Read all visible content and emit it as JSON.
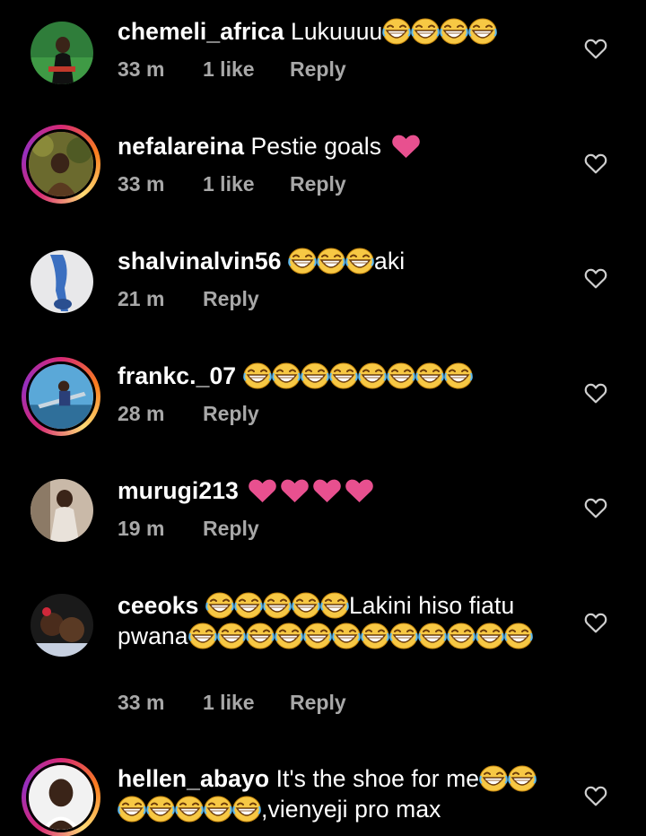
{
  "comments": [
    {
      "username": "chemeli_africa",
      "segments": [
        {
          "t": "text",
          "v": " Lukuuuu"
        },
        {
          "t": "emoji",
          "n": 4
        }
      ],
      "time": "33 m",
      "likes": "1 like",
      "reply": "Reply",
      "story_ring": false
    },
    {
      "username": "nefalareina",
      "segments": [
        {
          "t": "text",
          "v": " Pestie goals "
        },
        {
          "t": "heart",
          "n": 1
        }
      ],
      "time": "33 m",
      "likes": "1 like",
      "reply": "Reply",
      "story_ring": true
    },
    {
      "username": "shalvinalvin56",
      "segments": [
        {
          "t": "text",
          "v": " "
        },
        {
          "t": "emoji",
          "n": 3
        },
        {
          "t": "text",
          "v": "aki"
        }
      ],
      "time": "21 m",
      "likes": "",
      "reply": "Reply",
      "story_ring": false
    },
    {
      "username": "frankc._07",
      "segments": [
        {
          "t": "text",
          "v": " "
        },
        {
          "t": "emoji",
          "n": 8
        }
      ],
      "time": "28 m",
      "likes": "",
      "reply": "Reply",
      "story_ring": true
    },
    {
      "username": "murugi213",
      "segments": [
        {
          "t": "text",
          "v": " "
        },
        {
          "t": "heart",
          "n": 4
        }
      ],
      "time": "19 m",
      "likes": "",
      "reply": "Reply",
      "story_ring": false
    },
    {
      "username": "ceeoks",
      "segments": [
        {
          "t": "text",
          "v": " "
        },
        {
          "t": "emoji",
          "n": 5
        },
        {
          "t": "text",
          "v": "Lakini hiso fiatu pwana"
        },
        {
          "t": "emoji",
          "n": 12
        }
      ],
      "time": "33 m",
      "likes": "1 like",
      "reply": "Reply",
      "story_ring": false
    },
    {
      "username": "hellen_abayo",
      "segments": [
        {
          "t": "text",
          "v": " It's the shoe for me"
        },
        {
          "t": "emoji",
          "n": 7
        },
        {
          "t": "text",
          "v": ",vienyeji pro max"
        }
      ],
      "time": "",
      "likes": "",
      "reply": "",
      "story_ring": true
    }
  ],
  "icons": {
    "like": "heart-outline-icon",
    "emoji_laugh": "grinning-squinting-face-emoji",
    "emoji_heart": "pink-heart-emoji"
  },
  "colors": {
    "background": "#000000",
    "meta_text": "#a8a8a8",
    "heart_emoji": "#e8508f",
    "emoji_face": "#f7c844"
  }
}
